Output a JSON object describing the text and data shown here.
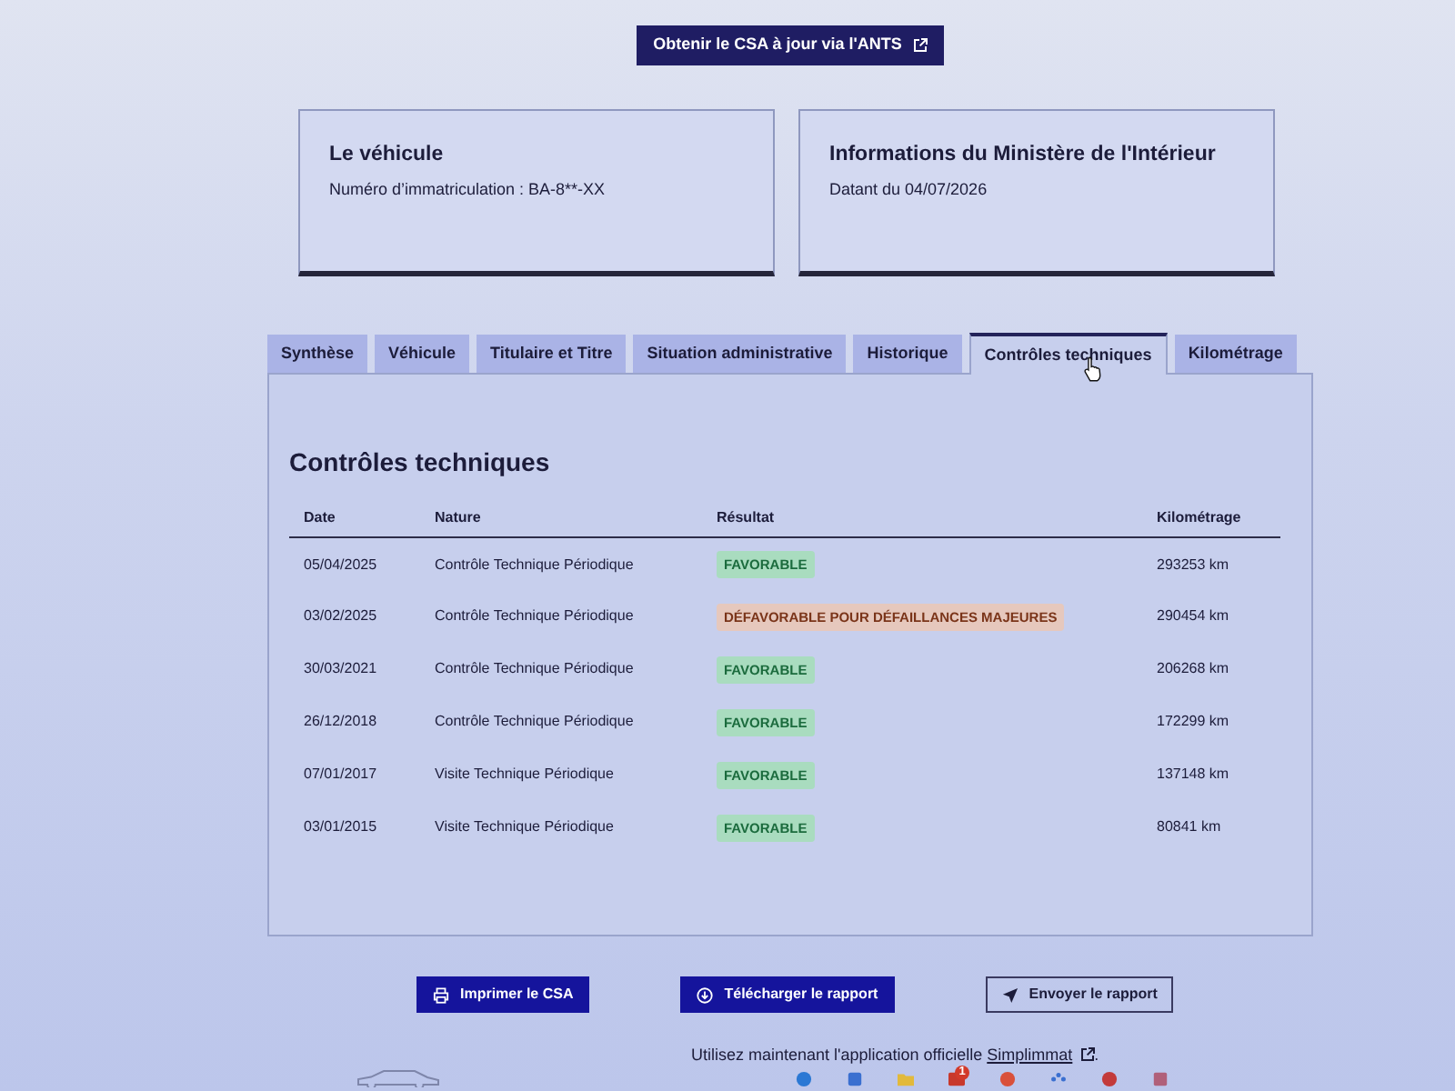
{
  "top_link": {
    "label": "Obtenir le CSA à jour via l'ANTS"
  },
  "cards": [
    {
      "title": "Le véhicule",
      "text": "Numéro d’immatriculation : BA-8**-XX"
    },
    {
      "title": "Informations du Ministère de l'Intérieur",
      "text": "Datant du 04/07/2026"
    }
  ],
  "tabs": [
    {
      "label": "Synthèse",
      "selected": false
    },
    {
      "label": "Véhicule",
      "selected": false
    },
    {
      "label": "Titulaire et Titre",
      "selected": false
    },
    {
      "label": "Situation administrative",
      "selected": false
    },
    {
      "label": "Historique",
      "selected": false
    },
    {
      "label": "Contrôles techniques",
      "selected": true
    },
    {
      "label": "Kilométrage",
      "selected": false
    }
  ],
  "panel": {
    "title": "Contrôles techniques",
    "columns": [
      "Date",
      "Nature",
      "Résultat",
      "Kilométrage"
    ],
    "rows": [
      {
        "date": "05/04/2025",
        "nature": "Contrôle Technique Périodique",
        "result": {
          "label": "FAVORABLE",
          "kind": "favorable"
        },
        "mileage": "293253 km"
      },
      {
        "date": "03/02/2025",
        "nature": "Contrôle Technique Périodique",
        "result": {
          "label": "DÉFAVORABLE POUR DÉFAILLANCES MAJEURES",
          "kind": "unfavorable"
        },
        "mileage": "290454 km"
      },
      {
        "date": "30/03/2021",
        "nature": "Contrôle Technique Périodique",
        "result": {
          "label": "FAVORABLE",
          "kind": "favorable"
        },
        "mileage": "206268 km"
      },
      {
        "date": "26/12/2018",
        "nature": "Contrôle Technique Périodique",
        "result": {
          "label": "FAVORABLE",
          "kind": "favorable"
        },
        "mileage": "172299 km"
      },
      {
        "date": "07/01/2017",
        "nature": "Visite Technique Périodique",
        "result": {
          "label": "FAVORABLE",
          "kind": "favorable"
        },
        "mileage": "137148 km"
      },
      {
        "date": "03/01/2015",
        "nature": "Visite Technique Périodique",
        "result": {
          "label": "FAVORABLE",
          "kind": "favorable"
        },
        "mileage": "80841 km"
      }
    ]
  },
  "actions": [
    {
      "label": "Imprimer le CSA",
      "kind": "print"
    },
    {
      "label": "Télécharger le rapport",
      "kind": "download"
    },
    {
      "label": "Envoyer le rapport",
      "kind": "send"
    }
  ],
  "footer": {
    "text": "Utilisez maintenant l'application officielle",
    "link": "Simplimmat",
    "end": "."
  },
  "taskbar": {
    "badge": "1"
  }
}
